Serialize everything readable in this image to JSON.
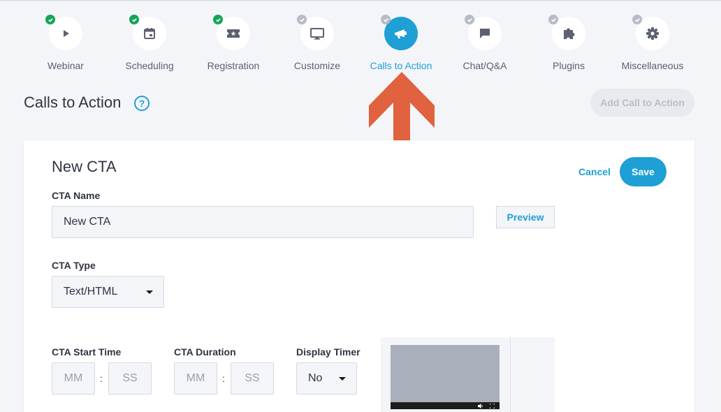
{
  "steps": [
    {
      "label": "Webinar",
      "icon": "play-icon",
      "status": "done"
    },
    {
      "label": "Scheduling",
      "icon": "calendar-icon",
      "status": "done"
    },
    {
      "label": "Registration",
      "icon": "ticket-icon",
      "status": "done"
    },
    {
      "label": "Customize",
      "icon": "monitor-icon",
      "status": "todo"
    },
    {
      "label": "Calls to Action",
      "icon": "megaphone-icon",
      "status": "active"
    },
    {
      "label": "Chat/Q&A",
      "icon": "chat-icon",
      "status": "todo"
    },
    {
      "label": "Plugins",
      "icon": "puzzle-icon",
      "status": "todo"
    },
    {
      "label": "Miscellaneous",
      "icon": "gear-icon",
      "status": "todo"
    }
  ],
  "page": {
    "title": "Calls to Action",
    "help_symbol": "?",
    "add_button": "Add Call to Action"
  },
  "form": {
    "title": "New CTA",
    "cancel": "Cancel",
    "save": "Save",
    "name_label": "CTA Name",
    "name_value": "New CTA",
    "preview": "Preview",
    "type_label": "CTA Type",
    "type_value": "Text/HTML",
    "start_label": "CTA Start Time",
    "start_mm": "MM",
    "start_ss": "SS",
    "duration_label": "CTA Duration",
    "duration_mm": "MM",
    "duration_ss": "SS",
    "timer_label": "Display Timer",
    "timer_value": "No",
    "colon": ":"
  },
  "colors": {
    "accent": "#1e9fd5",
    "done": "#16a35a",
    "todo": "#b7bcc6",
    "arrow": "#e0623f"
  }
}
